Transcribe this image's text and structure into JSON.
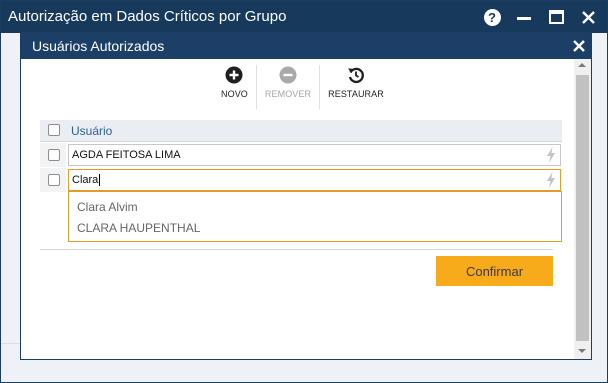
{
  "window": {
    "title": "Autorização em Dados Críticos por Grupo",
    "help_icon": "help-icon",
    "minimize_icon": "minimize-icon",
    "maximize_icon": "maximize-icon",
    "close_icon": "close-icon",
    "help_glyph": "?",
    "close_glyph": "✕"
  },
  "dialog": {
    "title": "Usuários Autorizados",
    "close_glyph": "✕"
  },
  "toolbar": {
    "buttons": [
      {
        "label": "NOVO",
        "icon": "plus-circle-icon",
        "enabled": true
      },
      {
        "label": "REMOVER",
        "icon": "minus-circle-icon",
        "enabled": false
      },
      {
        "label": "RESTAURAR",
        "icon": "restore-icon",
        "enabled": true
      }
    ]
  },
  "grid": {
    "header": "Usuário",
    "rows": [
      {
        "value": "AGDA FEITOSA LIMA",
        "active": false
      },
      {
        "value": "Clara",
        "active": true
      }
    ],
    "suggestions": [
      "Clara Alvim",
      "CLARA HAUPENTHAL"
    ]
  },
  "confirm_label": "Confirmar",
  "colors": {
    "titlebar": "#17395c",
    "dialog_titlebar": "#1b3f66",
    "header_text": "#2b5f99",
    "accent": "#f7aa1a",
    "active_border": "#e49b2a"
  }
}
